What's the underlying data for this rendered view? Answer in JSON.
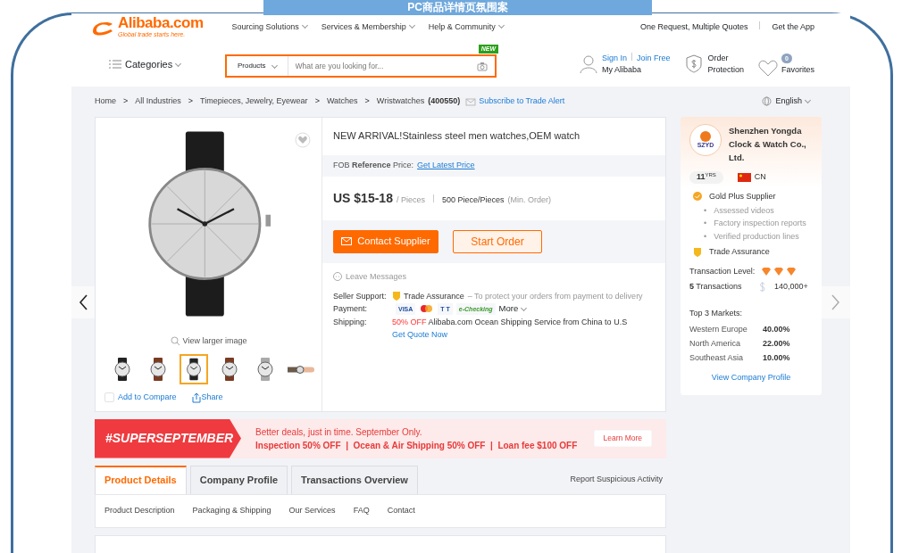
{
  "slide_title": "PC商品详情页氛围案",
  "header": {
    "logo": {
      "name": "Alibaba.com",
      "tagline": "Global trade starts here."
    },
    "nav": [
      "Sourcing Solutions",
      "Services & Membership",
      "Help & Community"
    ],
    "top_links": [
      "One Request, Multiple Quotes",
      "Get the App"
    ],
    "categories": "Categories",
    "search": {
      "scope": "Products",
      "placeholder": "What are you looking for...",
      "badge": "NEW"
    },
    "account": {
      "sign_in": "Sign In",
      "join": "Join Free",
      "my": "My Alibaba"
    },
    "order_protection": [
      "Order",
      "Protection"
    ],
    "favorites": {
      "label": "Favorites",
      "count": "0"
    }
  },
  "breadcrumb": {
    "items": [
      "Home",
      "All Industries",
      "Timepieces, Jewelry, Eyewear",
      "Watches",
      "Wristwatches"
    ],
    "separator": ">",
    "count": "(400550)",
    "subscribe": "Subscribe to Trade Alert"
  },
  "language": "English",
  "gallery": {
    "view_larger": "View larger image",
    "thumbnails": [
      {
        "kind": "black",
        "selected": false
      },
      {
        "kind": "brown",
        "selected": false
      },
      {
        "kind": "black",
        "selected": true
      },
      {
        "kind": "brown",
        "selected": false
      },
      {
        "kind": "steel",
        "selected": false
      },
      {
        "kind": "wrist",
        "selected": false
      }
    ],
    "compare": {
      "label": "Add to Compare",
      "checked": false
    },
    "share": "Share"
  },
  "product": {
    "title": "NEW ARRIVAL!Stainless steel men watches,OEM watch",
    "fob": "FOB **Reference** Price:",
    "fob_link": "Get Latest Price",
    "price": "US $15-18",
    "unit": "/ Pieces",
    "moq": "500 Piece/Pieces",
    "moq_note": "(Min. Order)",
    "buttons": [
      {
        "label": "Contact Supplier",
        "kind": "primary"
      },
      {
        "label": "Start Order",
        "kind": "outline"
      }
    ],
    "leave_messages": "Leave Messages",
    "seller_support": {
      "label": "Seller Support:",
      "value": "Trade Assurance",
      "note": "– To protect your orders from payment to delivery"
    },
    "payment": {
      "label": "Payment:",
      "methods": [
        {
          "kind": "visa",
          "label": "VISA"
        },
        {
          "kind": "mastercard"
        },
        {
          "kind": "tt",
          "label": "T T"
        },
        {
          "kind": "echeck",
          "label": "e-Checking"
        }
      ],
      "more": "More"
    },
    "shipping": {
      "label": "Shipping:",
      "offer": "50% OFF",
      "text": "Alibaba.com Ocean Shipping Service from China to U.S",
      "link": "Get Quote Now"
    }
  },
  "supplier": {
    "logo_text": "SZYD",
    "name": "Shenzhen Yongda Clock & Watch Co., Ltd.",
    "years": "11",
    "years_unit": "YRS",
    "country": "CN",
    "gold": "Gold Plus Supplier",
    "features": [
      {
        "marker": "•",
        "text": "Assessed videos"
      },
      {
        "marker": "•",
        "text": "Factory inspection reports"
      },
      {
        "marker": "•",
        "text": "Verified production lines"
      }
    ],
    "trade": "Trade Assurance",
    "level_label": "Transaction Level:",
    "stars": 3,
    "transactions": "**5** Transactions",
    "volume": "140,000+",
    "markets_title": "Top 3 Markets:",
    "markets": [
      {
        "region": "Western Europe",
        "share": "40.00%"
      },
      {
        "region": "North America",
        "share": "22.00%"
      },
      {
        "region": "Southeast Asia",
        "share": "10.00%"
      }
    ],
    "profile_link": "View Company Profile"
  },
  "promo": {
    "tag": "#SUPERSEPTEMBER",
    "line1": "Better deals, just in time. September Only.",
    "line2": "Inspection 50% OFF  |  Ocean & Air Shipping 50% OFF  |  Loan fee $100 OFF",
    "button": "Learn More"
  },
  "tabs": [
    {
      "label": "Product Details",
      "selected": true
    },
    {
      "label": "Company Profile",
      "selected": false
    },
    {
      "label": "Transactions Overview",
      "selected": false
    }
  ],
  "report": "Report Suspicious Activity",
  "subnav": [
    "Product Description",
    "Packaging & Shipping",
    "Our Services",
    "FAQ",
    "Contact"
  ]
}
